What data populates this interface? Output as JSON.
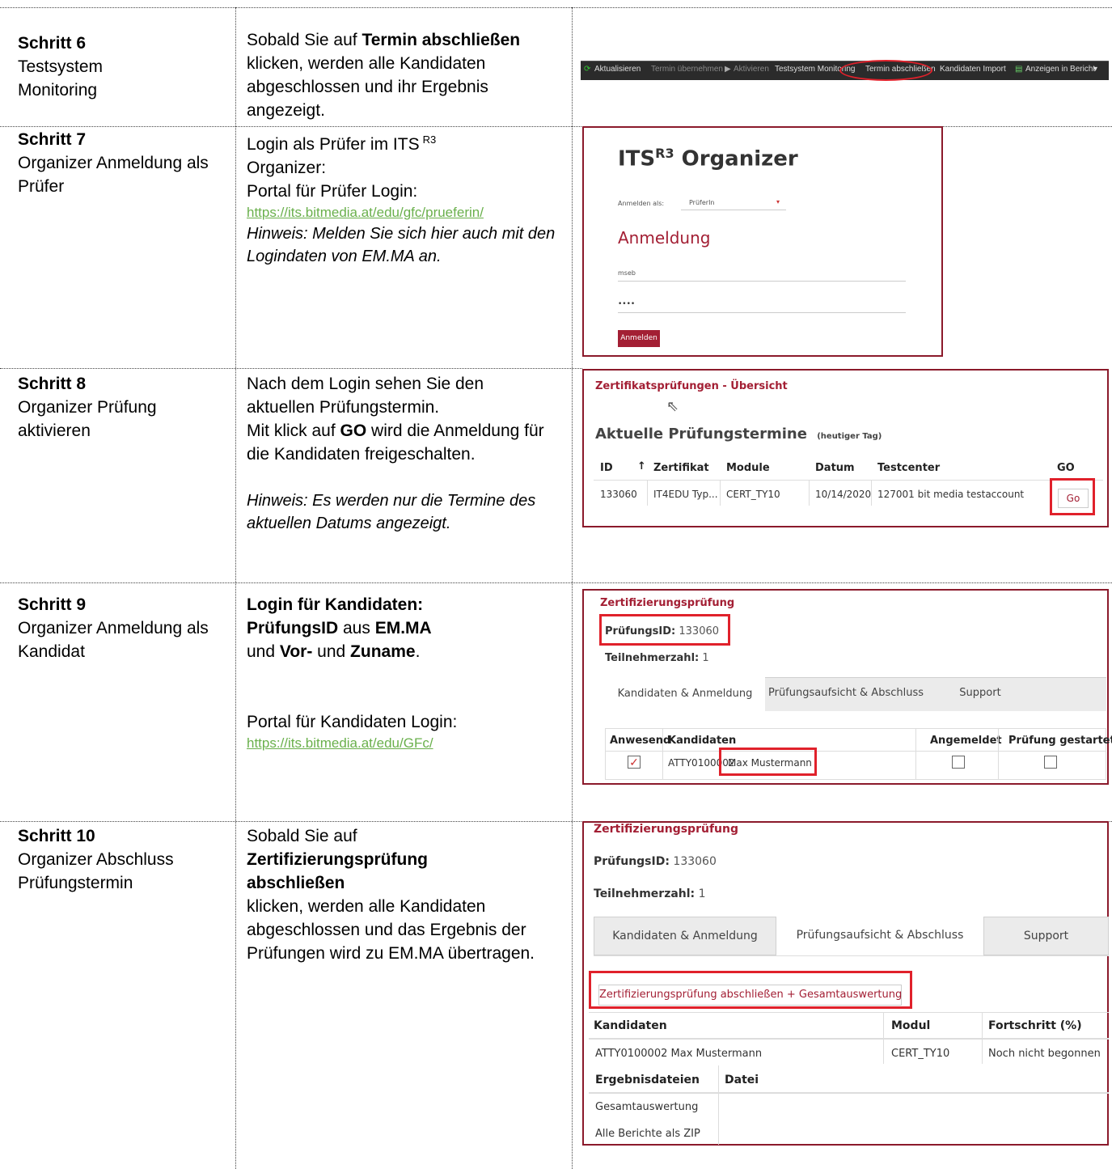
{
  "steps": [
    {
      "title": "Schritt 6",
      "subtitle": "Testsystem Monitoring",
      "desc_pre": "Sobald Sie auf ",
      "desc_bold": "Termin abschließen",
      "desc_post": " klicken, werden alle Kandidaten abgeschlossen und ihr Ergebnis angezeigt."
    },
    {
      "title": "Schritt 7",
      "subtitle": "Organizer Anmeldung als Prüfer",
      "desc_line1": "Login als Prüfer im ITS",
      "desc_sup": "R3",
      "desc_line2": "Organizer:",
      "desc_line3": "Portal für Prüfer Login:",
      "link": "https://its.bitmedia.at/edu/gfc/prueferin/",
      "hint": "Hinweis: Melden Sie sich hier auch mit den Logindaten von EM.MA an."
    },
    {
      "title": "Schritt 8",
      "subtitle": "Organizer Prüfung aktivieren",
      "desc_line1": "Nach dem Login sehen Sie den aktuellen Prüfungstermin.",
      "desc_pre": "Mit klick auf ",
      "desc_bold": "GO",
      "desc_post": " wird die Anmeldung für die Kandidaten freigeschalten.",
      "hint": "Hinweis: Es werden nur die Termine des aktuellen Datums angezeigt."
    },
    {
      "title": "Schritt 9",
      "subtitle": "Organizer Anmeldung als Kandidat",
      "bold1": "Login für Kandidaten:",
      "bold2": "PrüfungsID",
      "mid1": " aus ",
      "bold3": "EM.MA",
      "pre2": "und ",
      "bold4": "Vor-",
      "mid2": " und ",
      "bold5": "Zuname",
      "end": ".",
      "portal": "Portal für Kandidaten Login:",
      "link": "https://its.bitmedia.at/edu/GFc/"
    },
    {
      "title": "Schritt 10",
      "subtitle": "Organizer Abschluss Prüfungstermin",
      "desc_pre": "Sobald Sie auf",
      "desc_bold": "Zertifizierungsprüfung abschließen",
      "desc_post": "klicken, werden alle Kandidaten abgeschlossen und das Ergebnis der Prüfungen wird zu EM.MA übertragen."
    }
  ],
  "toolbar": {
    "items": [
      "Aktualisieren",
      "Termin übernehmen",
      "Aktivieren",
      "Testsystem Monitoring",
      "Termin abschließen",
      "Kandidaten Import",
      "Anzeigen in Bericht"
    ]
  },
  "login": {
    "title": "ITS",
    "title_sup": "R3",
    "title_rest": " Organizer",
    "as_label": "Anmelden als:",
    "as_value": "PrüferIn",
    "heading": "Anmeldung",
    "user": "mseb",
    "password": "••••",
    "button": "Anmelden"
  },
  "overview": {
    "title": "Zertifikatsprüfungen - Übersicht",
    "heading": "Aktuelle Prüfungstermine",
    "heading_small": "(heutiger Tag)",
    "columns": [
      "ID",
      "↑",
      "Zertifikat",
      "Module",
      "Datum",
      "Testcenter",
      "GO"
    ],
    "row": [
      "133060",
      "IT4EDU Typ...",
      "CERT_TY10",
      "10/14/2020",
      "127001 bit media testaccount"
    ],
    "go": "Go"
  },
  "exam1": {
    "title": "Zertifizierungsprüfung",
    "id_label": "PrüfungsID:",
    "id_value": "133060",
    "count_label": "Teilnehmerzahl:",
    "count_value": "1",
    "tabs": [
      "Kandidaten & Anmeldung",
      "Prüfungsaufsicht & Abschluss",
      "Support"
    ],
    "columns": [
      "Anwesend",
      "Kandidaten",
      "Angemeldet",
      "Prüfung gestartet"
    ],
    "cand_id": "ATTY0100002",
    "cand_name": "Max Mustermann",
    "check": "✓"
  },
  "exam2": {
    "title": "Zertifizierungsprüfung",
    "id_label": "PrüfungsID:",
    "id_value": "133060",
    "count_label": "Teilnehmerzahl:",
    "count_value": "1",
    "tabs": [
      "Kandidaten & Anmeldung",
      "Prüfungsaufsicht & Abschluss",
      "Support"
    ],
    "close_button": "Zertifizierungsprüfung abschließen + Gesamtauswertung",
    "columns": [
      "Kandidaten",
      "Modul",
      "Fortschritt (%)"
    ],
    "row": [
      "ATTY0100002 Max Mustermann",
      "CERT_TY10",
      "Noch nicht begonnen"
    ],
    "files_header": [
      "Ergebnisdateien",
      "Datei"
    ],
    "files": [
      "Gesamtauswertung",
      "Alle Berichte als ZIP"
    ]
  }
}
